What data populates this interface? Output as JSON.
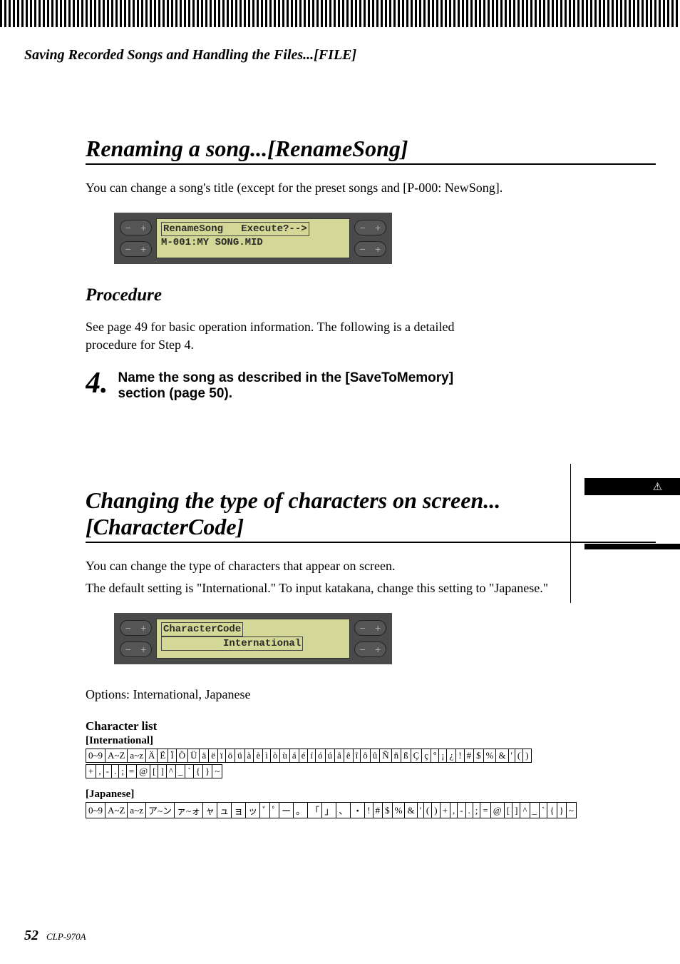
{
  "header": {
    "title": "Saving Recorded Songs and Handling the Files...[FILE]"
  },
  "section1": {
    "heading": "Renaming a song...[RenameSong]",
    "intro": "You can change a song's title (except for the preset songs and [P-000: NewSong].",
    "lcd": {
      "line1": "RenameSong   Execute?-->",
      "line2": "M-001:MY SONG.MID"
    },
    "procedure_heading": "Procedure",
    "procedure_text": "See page 49 for basic operation information. The following is a detailed procedure for Step 4.",
    "step": {
      "num": "4.",
      "text": "Name the song as described in the [SaveToMemory] section (page 50)."
    },
    "caution_icon": "⚠"
  },
  "section2": {
    "heading": "Changing the type of characters on screen...[CharacterCode]",
    "intro1": "You can change the type of characters that appear on screen.",
    "intro2": "The default setting is \"International.\" To input katakana, change this setting to \"Japanese.\"",
    "lcd": {
      "line1": "CharacterCode",
      "line2": "          International"
    },
    "options": "Options: International, Japanese",
    "char_list_label": "Character list",
    "intl_label": "[International]",
    "intl_row1": [
      "0~9",
      "A~Z",
      "a~z",
      "Ä",
      "Ë",
      "Ï",
      "Ö",
      "Ü",
      "ä",
      "ë",
      "ï",
      "ö",
      "ü",
      "à",
      "è",
      "ì",
      "ò",
      "ù",
      "á",
      "é",
      "í",
      "ó",
      "ú",
      "â",
      "ê",
      "î",
      "ô",
      "û",
      "Ñ",
      "ñ",
      "ß",
      "Ç",
      "ç",
      "º",
      "¡",
      "¿",
      "!",
      "#",
      "$",
      "%",
      "&",
      "'",
      "(",
      ")"
    ],
    "intl_row2": [
      "+",
      ",",
      "-",
      ".",
      ";",
      "=",
      "@",
      "[",
      "]",
      "^",
      "_",
      "`",
      "{",
      "}",
      "~"
    ],
    "jp_label": "[Japanese]",
    "jp_row": [
      "0~9",
      "A~Z",
      "a~z",
      "ア~ン",
      "ァ~ォ",
      "ャ",
      "ュ",
      "ョ",
      "ッ",
      "ﾞ",
      "ﾟ",
      "ー",
      "。",
      "「",
      "」",
      "、",
      "・",
      "!",
      "#",
      "$",
      "%",
      "&",
      "'",
      "(",
      ")",
      "+",
      ",",
      "-",
      ".",
      ";",
      "=",
      "@",
      "[",
      "]",
      "^",
      "_",
      "`",
      "{",
      "}",
      "~"
    ]
  },
  "footer": {
    "page": "52",
    "model": "CLP-970A"
  },
  "buttons": {
    "minus": "−",
    "plus": "+"
  }
}
